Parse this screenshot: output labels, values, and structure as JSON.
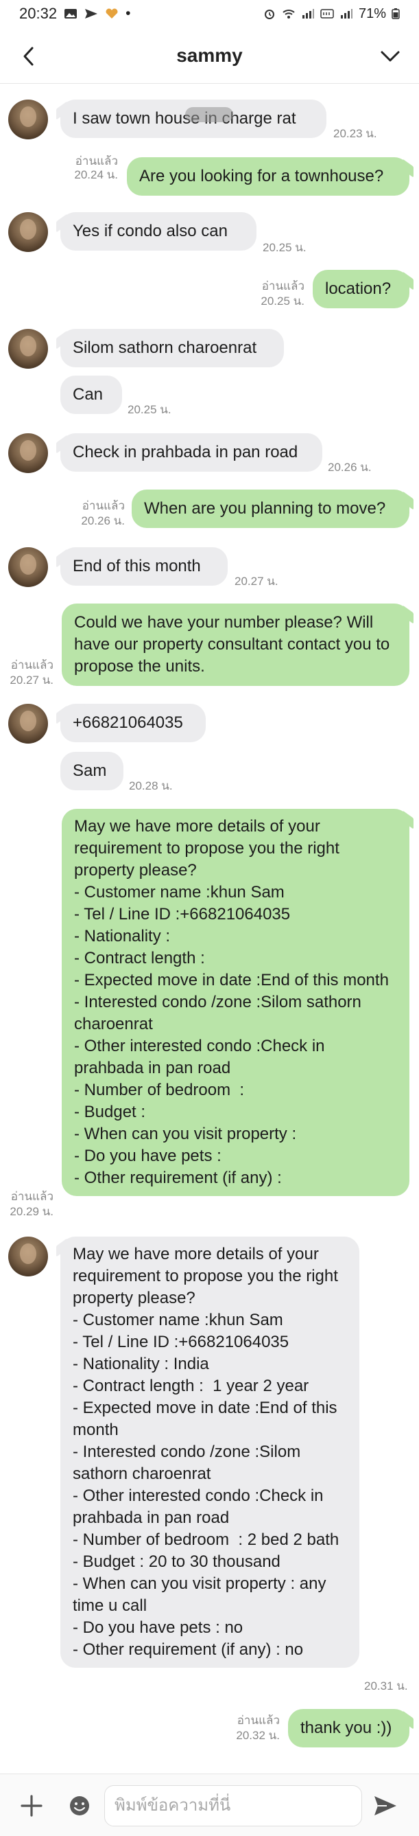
{
  "status_bar": {
    "time": "20:32",
    "dot": "•",
    "battery": "71%",
    "icons": [
      "gallery-icon",
      "send-icon",
      "heart-icon",
      "alarm-icon",
      "wifi-icon",
      "signal-icon",
      "volte-icon",
      "signal-icon",
      "battery-icon"
    ]
  },
  "header": {
    "title": "sammy",
    "back_icon": "chevron-left-icon",
    "menu_icon": "chevron-down-icon"
  },
  "messages": [
    {
      "dir": "in",
      "text": "I saw town house in charge rat",
      "time": "20.23 น."
    },
    {
      "dir": "out",
      "text": "Are you looking for a townhouse?",
      "read": "อ่านแล้ว",
      "time": "20.24 น."
    },
    {
      "dir": "in",
      "text": "Yes if condo also can",
      "time": "20.25 น."
    },
    {
      "dir": "out",
      "text": "location?",
      "read": "อ่านแล้ว",
      "time": "20.25 น."
    },
    {
      "dir": "in",
      "text": "Silom sathorn charoenrat",
      "time": ""
    },
    {
      "dir": "in",
      "text": "Can",
      "time": "20.25 น."
    },
    {
      "dir": "in",
      "text": "Check in prahbada in pan road",
      "time": "20.26 น."
    },
    {
      "dir": "out",
      "text": "When are you planning to move?",
      "read": "อ่านแล้ว",
      "time": "20.26 น."
    },
    {
      "dir": "in",
      "text": "End of this month",
      "time": "20.27 น."
    },
    {
      "dir": "out",
      "text": "Could we have your number please? Will have our property consultant contact you to propose the units.",
      "read": "อ่านแล้ว",
      "time": "20.27 น."
    },
    {
      "dir": "in",
      "text": "+66821064035",
      "time": ""
    },
    {
      "dir": "in",
      "text": "Sam",
      "time": "20.28 น."
    },
    {
      "dir": "out",
      "text": "May we have more details of your requirement to propose you the right property please?\n- Customer name :khun Sam\n- Tel / Line ID :+66821064035\n- Nationality :\n- Contract length :\n- Expected move in date :End of this month\n- Interested condo /zone :Silom sathorn charoenrat\n- Other interested condo :Check in prahbada in pan road\n- Number of bedroom  :\n- Budget :\n- When can you visit property :\n- Do you have pets :\n- Other requirement (if any) :",
      "read": "อ่านแล้ว",
      "time": "20.29 น."
    },
    {
      "dir": "in",
      "text": "May we have more details of your requirement to propose you the right property please?\n- Customer name :khun Sam\n- Tel / Line ID :+66821064035\n- Nationality : India\n- Contract length :  1 year 2 year\n- Expected move in date :End of this month\n- Interested condo /zone :Silom sathorn charoenrat\n- Other interested condo :Check in prahbada in pan road\n- Number of bedroom  : 2 bed 2 bath\n- Budget : 20 to 30 thousand\n- When can you visit property : any time u call\n- Do you have pets : no\n- Other requirement (if any) : no",
      "time": "20.31 น."
    },
    {
      "dir": "out",
      "text": "thank you :))",
      "read": "อ่านแล้ว",
      "time": "20.32 น."
    }
  ],
  "input_bar": {
    "placeholder": "พิมพ์ข้อความที่นี่",
    "plus_icon": "plus-icon",
    "emoji_icon": "emoji-icon",
    "send_icon": "send-icon"
  },
  "colors": {
    "incoming_bubble": "#ececee",
    "outgoing_bubble": "#b9e4a8",
    "meta_text": "#888888"
  }
}
